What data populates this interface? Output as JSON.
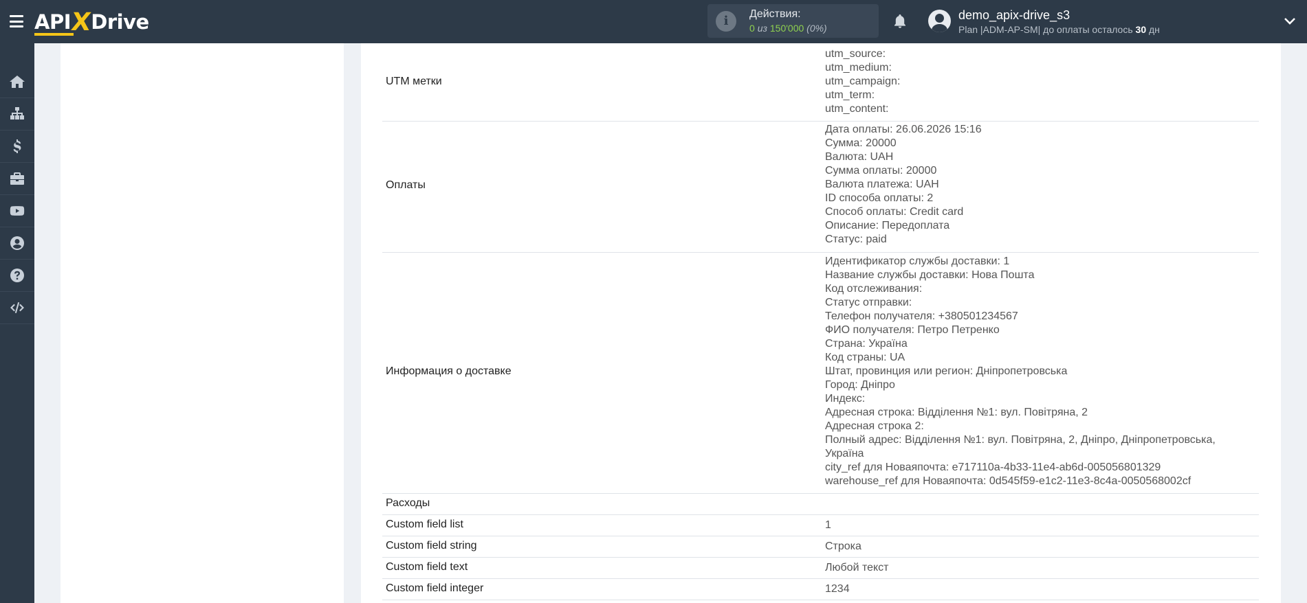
{
  "header": {
    "logo": {
      "part1": "API",
      "part2": "X",
      "part3": "Drive"
    },
    "actions": {
      "label": "Действия:",
      "used": "0",
      "of": "из",
      "total": "150'000",
      "percent": "(0%)"
    },
    "user": {
      "name": "demo_apix-drive_s3",
      "plan_prefix": "Plan |ADM-AP-SM| до оплаты осталось ",
      "days": "30",
      "days_suffix": " дн"
    }
  },
  "sidebar": {
    "items": [
      {
        "icon": "home-icon"
      },
      {
        "icon": "sitemap-icon"
      },
      {
        "icon": "dollar-icon"
      },
      {
        "icon": "briefcase-icon"
      },
      {
        "icon": "youtube-icon"
      },
      {
        "icon": "user-circle-icon"
      },
      {
        "icon": "question-icon"
      },
      {
        "icon": "code-icon"
      }
    ]
  },
  "rows": [
    {
      "key": "UTM метки",
      "values": [
        "utm_source:",
        "utm_medium:",
        "utm_campaign:",
        "utm_term:",
        "utm_content:"
      ]
    },
    {
      "key": "Оплаты",
      "values": [
        "Дата оплаты: 26.06.2026 15:16",
        "Сумма: 20000",
        "Валюта: UAH",
        "Сумма оплаты: 20000",
        "Валюта платежа: UAH",
        "ID способа оплаты: 2",
        "Способ оплаты: Credit card",
        "Описание: Передоплата",
        "Статус: paid"
      ]
    },
    {
      "key": "Информация о доставке",
      "values": [
        "Идентификатор службы доставки: 1",
        "Название службы доставки: Нова Пошта",
        "Код отслеживания:",
        "Статус отправки:",
        "Телефон получателя: +380501234567",
        "ФИО получателя: Петро Петренко",
        "Страна: Україна",
        "Код страны: UA",
        "Штат, провинция или регион: Дніпропетровська",
        "Город: Дніпро",
        "Индекс:",
        "Адресная строка: Відділення №1: вул. Повітряна, 2",
        "Адресная строка 2:",
        "Полный адрес: Відділення №1: вул. Повітряна, 2, Дніпро, Дніпропетровська, Україна",
        "city_ref для Новаяпочта: e717110a-4b33-11e4-ab6d-005056801329",
        "warehouse_ref для Новаяпочта: 0d545f59-e1c2-11e3-8c4a-0050568002cf"
      ]
    },
    {
      "key": "Расходы",
      "values": [
        ""
      ]
    },
    {
      "key": "Custom field list",
      "values": [
        "1"
      ]
    },
    {
      "key": "Custom field string",
      "values": [
        "Строка"
      ]
    },
    {
      "key": "Custom field text",
      "values": [
        "Любой текст"
      ]
    },
    {
      "key": "Custom field integer",
      "values": [
        "1234"
      ]
    }
  ]
}
